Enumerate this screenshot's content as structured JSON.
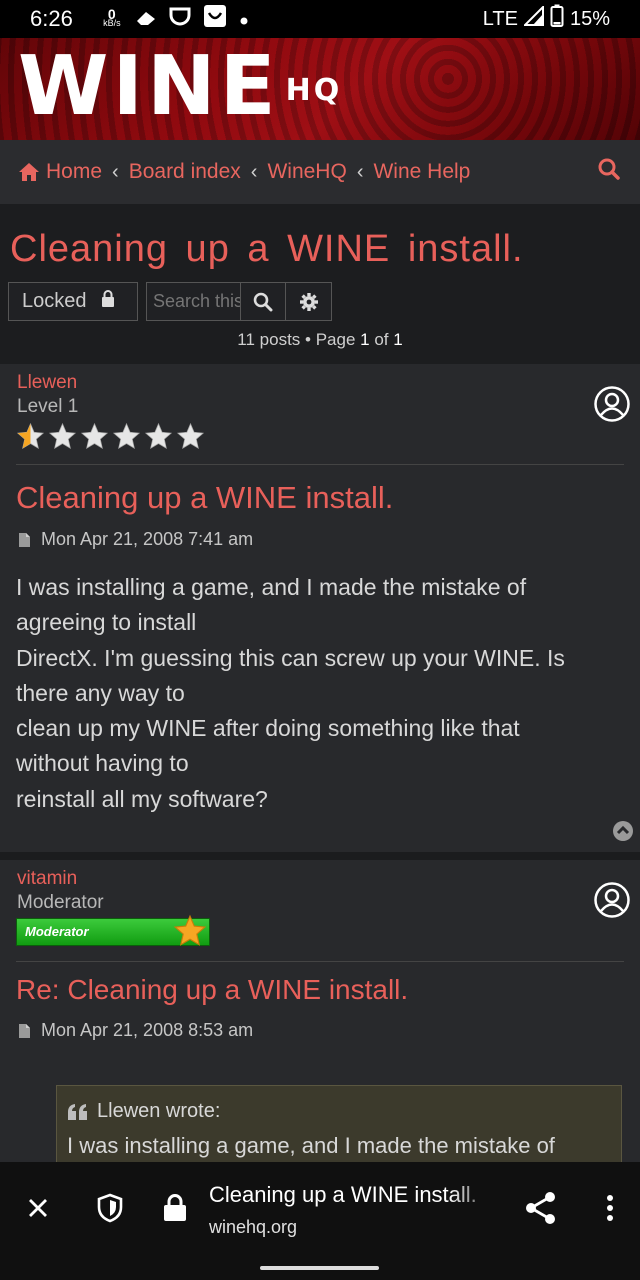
{
  "status": {
    "time": "6:26",
    "net_value": "0",
    "net_unit": "kB/s",
    "network": "LTE",
    "battery": "15%"
  },
  "banner": {
    "logo_main": "WINE",
    "logo_sup": "HQ"
  },
  "breadcrumb": {
    "home": "Home",
    "items": [
      "Board index",
      "WineHQ",
      "Wine Help"
    ],
    "separator": "‹"
  },
  "topic": {
    "title": "Cleaning up a WINE install.",
    "locked_label": "Locked",
    "search_placeholder": "Search this topic…",
    "pagination_prefix": "11 posts • Page ",
    "page_current": "1",
    "pagination_of": " of ",
    "page_total": "1"
  },
  "posts": [
    {
      "author": "Llewen",
      "rank": "Level 1",
      "star_rating": 0.5,
      "star_max": 6,
      "title": "Cleaning up a WINE install.",
      "date": "Mon Apr 21, 2008 7:41 am",
      "body_lines": [
        "I was installing a game, and I made the mistake of",
        "agreeing to install",
        "DirectX. I'm guessing this can screw up your WINE. Is",
        "there any way to",
        "clean up my WINE after doing something like that",
        "without having to",
        "reinstall all my software?"
      ]
    },
    {
      "author": "vitamin",
      "rank": "Moderator",
      "badge": "Moderator",
      "title": "Re: Cleaning up a WINE install.",
      "date": "Mon Apr 21, 2008 8:53 am",
      "quote_author": "Llewen wrote:",
      "quote_text": "I was installing a game, and I made the mistake of"
    }
  ],
  "browser": {
    "page_title": "Cleaning up a WINE install.",
    "host": "winehq.org"
  },
  "colors": {
    "accent": "#e8605a",
    "banner": "#8a0a10",
    "post_bg": "#28292c",
    "quote_bg": "#3c3a2c"
  }
}
